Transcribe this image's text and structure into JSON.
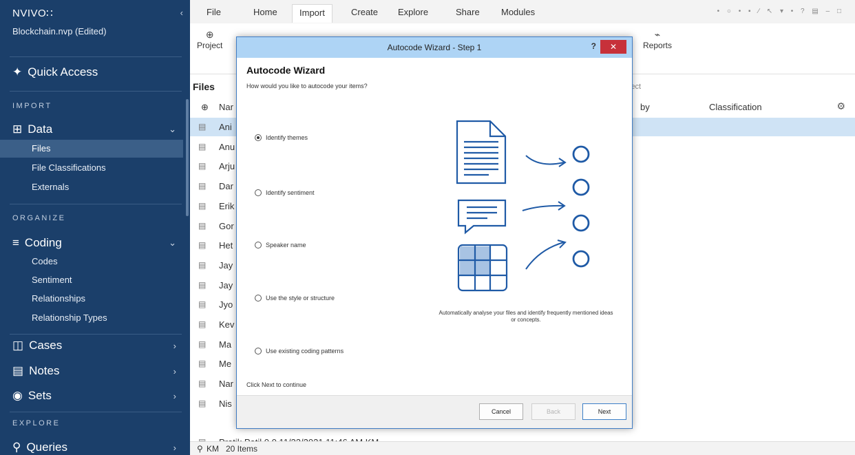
{
  "app": {
    "logo": "NVIVO∷",
    "project": "Blockchain.nvp (Edited)",
    "collapse_glyph": "‹"
  },
  "sidebar": {
    "quick_access": "Quick Access",
    "sections": {
      "import": "IMPORT",
      "organize": "ORGANIZE",
      "explore": "EXPLORE"
    },
    "groups": {
      "data": {
        "label": "Data",
        "chevron": "⌄",
        "items": [
          "Files",
          "File Classifications",
          "Externals"
        ]
      },
      "coding": {
        "label": "Coding",
        "chevron": "⌄",
        "items": [
          "Codes",
          "Sentiment",
          "Relationships",
          "Relationship Types"
        ]
      },
      "cases": {
        "label": "Cases",
        "chevron": "›"
      },
      "notes": {
        "label": "Notes",
        "chevron": "›"
      },
      "sets": {
        "label": "Sets",
        "chevron": "›"
      },
      "queries": {
        "label": "Queries",
        "chevron": "›"
      }
    }
  },
  "ribbon": {
    "tabs": [
      "File",
      "Home",
      "Import",
      "Create",
      "Explore",
      "Share",
      "Modules"
    ],
    "active_tab": "Import",
    "window_icons": "• ○ • ▪ ∕ ↖ ▾ • ? ▤ – □",
    "buttons": {
      "project": "Project",
      "reports": "Reports"
    }
  },
  "files": {
    "title": "Files",
    "search_placeholder": "ject",
    "columns": {
      "name": "Nar",
      "by": "by",
      "classification": "Classification"
    },
    "rows": [
      "Ani",
      "Anu",
      "Arju",
      "Dar",
      "Erik",
      "Gor",
      "Het",
      "Jay",
      "Jay",
      "Jyo",
      "Kev",
      "Ma",
      "Me",
      "Nar",
      "Nis"
    ],
    "partial_row": "Pratik Patil        0              0                  11/22/2021 11:46 AM        KM"
  },
  "statusbar": {
    "user": "KM",
    "count": "20 Items"
  },
  "dialog": {
    "title": "Autocode Wizard - Step 1",
    "help": "?",
    "close": "✕",
    "heading": "Autocode Wizard",
    "question": "How would you like to autocode your items?",
    "options": [
      "Identify themes",
      "Identify sentiment",
      "Speaker name",
      "Use the style or structure",
      "Use existing coding patterns"
    ],
    "selected_index": 0,
    "description": "Automatically analyse your files and identify frequently mentioned ideas or concepts.",
    "hint": "Click Next to continue",
    "buttons": {
      "cancel": "Cancel",
      "back": "Back",
      "next": "Next"
    }
  },
  "colors": {
    "sidebar": "#1b3f6a",
    "sidebar_active": "#3b5f88",
    "accent": "#1f5aa6",
    "selected_row": "#cfe3f5",
    "close": "#c7313a",
    "dialog_title": "#aed4f5"
  }
}
